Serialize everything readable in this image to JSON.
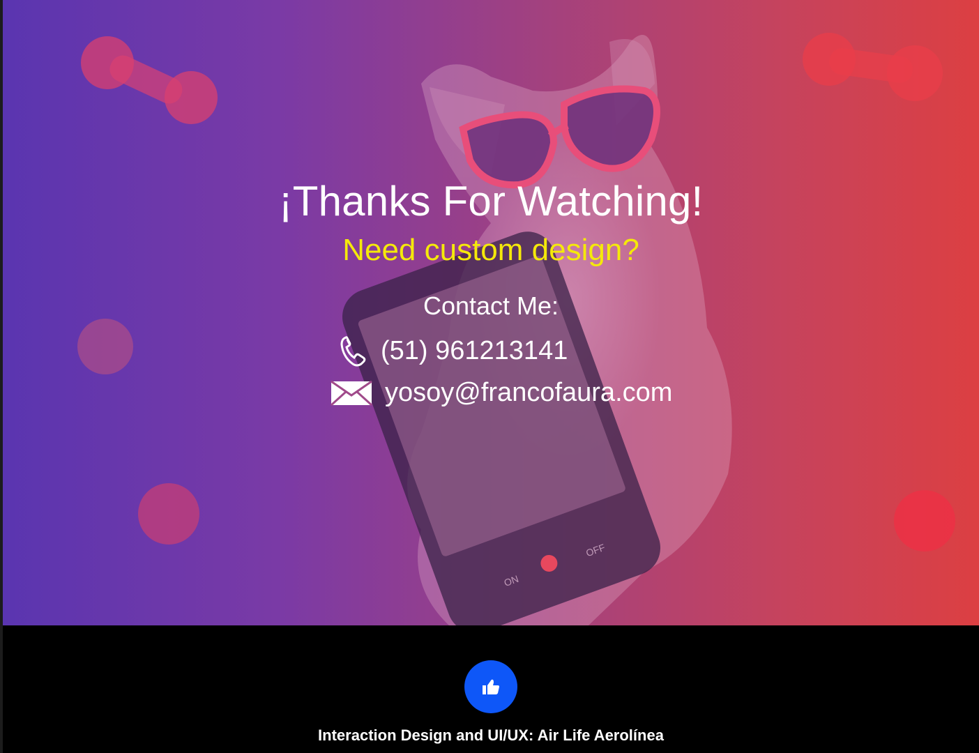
{
  "hero": {
    "title": "¡Thanks For Watching!",
    "subtitle": "Need custom design?",
    "contact_heading": "Contact Me:",
    "phone": "(51) 961213141",
    "email": "yosoy@francofaura.com",
    "phone_icon": "phone-icon",
    "email_icon": "envelope-icon",
    "artwork": {
      "phone_screen_labels": {
        "on": "ON",
        "off": "OFF"
      }
    }
  },
  "footer": {
    "like_icon": "thumbs-up-icon",
    "caption": "Interaction Design and UI/UX: Air Life Aerolínea"
  },
  "colors": {
    "gradient_left": "#5a35b0",
    "gradient_right": "#dc3f42",
    "subtitle": "#f5e90a",
    "like_button": "#0e57f8",
    "footer_background": "#000000"
  }
}
